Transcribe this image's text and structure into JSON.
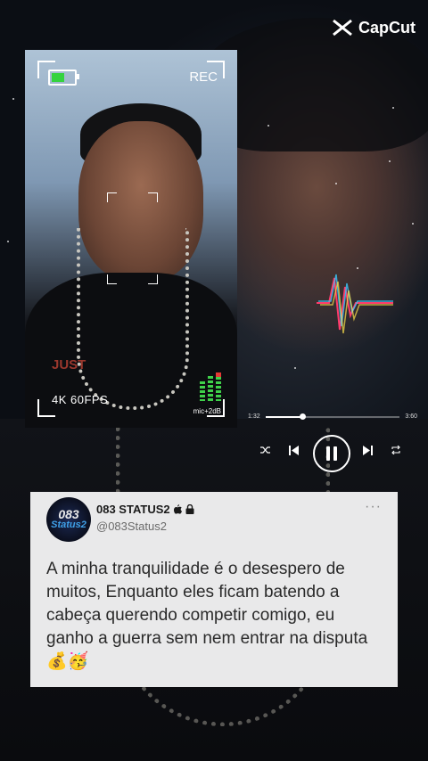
{
  "brand": {
    "name": "CapCut"
  },
  "camera_card": {
    "rec_label": "REC",
    "format_label": "4K  60FPS",
    "mic_label": "mic+2dB",
    "battery_level": 0.6,
    "shirt_text": "JUST"
  },
  "player": {
    "elapsed": "1:32",
    "duration": "3:60",
    "progress": 0.27,
    "icons": [
      "shuffle-icon",
      "previous-icon",
      "pause-icon",
      "next-icon",
      "repeat-icon"
    ]
  },
  "tweet": {
    "avatar_line1": "083",
    "avatar_line2": "Status2",
    "display_name": "083 STATUS2",
    "handle": "@083Status2",
    "more": "···",
    "body": "A minha tranquilidade é o desespero de muitos, Enquanto eles ficam batendo a cabeça querendo competir comigo, eu ganho a guerra sem nem entrar na disputa 💰🥳"
  },
  "colors": {
    "accent_green": "#35d33f",
    "rec_red": "#e53935",
    "tweet_bg": "#e9e9ea"
  }
}
